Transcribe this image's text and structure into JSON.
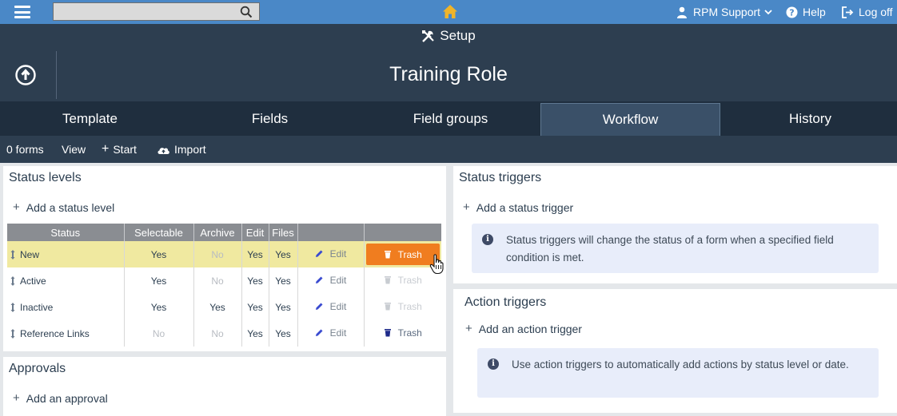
{
  "topbar": {
    "search": {
      "value": "",
      "placeholder": ""
    },
    "user_label": "RPM Support",
    "help_label": "Help",
    "logoff_label": "Log off"
  },
  "header": {
    "section": "Setup",
    "title": "Training Role"
  },
  "tabs": [
    {
      "label": "Template",
      "active": false
    },
    {
      "label": "Fields",
      "active": false
    },
    {
      "label": "Field groups",
      "active": false
    },
    {
      "label": "Workflow",
      "active": true
    },
    {
      "label": "History",
      "active": false
    }
  ],
  "toolbar": {
    "forms": "0 forms",
    "view": "View",
    "start": "Start",
    "import": "Import"
  },
  "status_levels": {
    "title": "Status levels",
    "add_label": "Add a status level",
    "columns": [
      "Status",
      "Selectable",
      "Archive",
      "Edit",
      "Files"
    ],
    "edit_label": "Edit",
    "trash_label": "Trash",
    "rows": [
      {
        "name": "New",
        "selectable": "Yes",
        "archive": "No",
        "edit": "Yes",
        "files": "Yes",
        "selected": true,
        "trash": "active"
      },
      {
        "name": "Active",
        "selectable": "Yes",
        "archive": "No",
        "edit": "Yes",
        "files": "Yes",
        "selected": false,
        "trash": "disabled"
      },
      {
        "name": "Inactive",
        "selectable": "Yes",
        "archive": "Yes",
        "edit": "Yes",
        "files": "Yes",
        "selected": false,
        "trash": "disabled"
      },
      {
        "name": "Reference Links",
        "selectable": "No",
        "archive": "No",
        "edit": "Yes",
        "files": "Yes",
        "selected": false,
        "trash": "enabled"
      }
    ]
  },
  "approvals": {
    "title": "Approvals",
    "add_label": "Add an approval"
  },
  "status_triggers": {
    "title": "Status triggers",
    "add_label": "Add a status trigger",
    "info": "Status triggers will change the status of a form when a specified field condition is met."
  },
  "action_triggers": {
    "title": "Action triggers",
    "add_label": "Add an action trigger",
    "info": "Use action triggers to automatically add actions by status level or date."
  },
  "colors": {
    "topbar": "#4a88c7",
    "header": "#2d3e50",
    "tabs": "#1f2e3e",
    "accent": "#f07d1f",
    "selected_row": "#f0e9a0"
  }
}
